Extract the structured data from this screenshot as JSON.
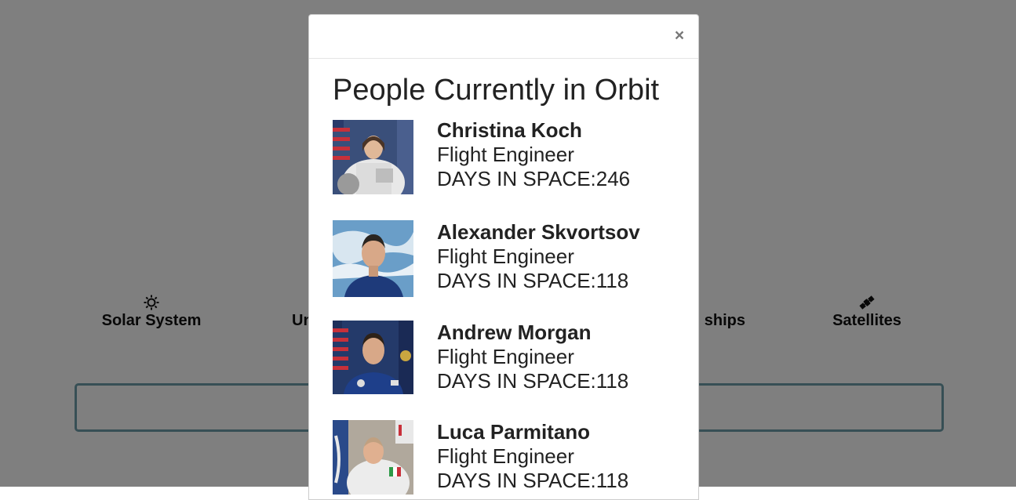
{
  "background": {
    "nav": [
      {
        "label": "Solar System",
        "icon": "sun-icon"
      },
      {
        "label": "Un",
        "icon": ""
      },
      {
        "label": "ships",
        "icon": ""
      },
      {
        "label": "Satellites",
        "icon": "satellite-icon"
      }
    ]
  },
  "modal": {
    "close_label": "×",
    "title": "People Currently in Orbit",
    "people": [
      {
        "name": "Christina Koch",
        "role": "Flight Engineer",
        "days_text": "DAYS IN SPACE:246"
      },
      {
        "name": "Alexander Skvortsov",
        "role": "Flight Engineer",
        "days_text": "DAYS IN SPACE:118"
      },
      {
        "name": "Andrew Morgan",
        "role": "Flight Engineer",
        "days_text": "DAYS IN SPACE:118"
      },
      {
        "name": "Luca Parmitano",
        "role": "Flight Engineer",
        "days_text": "DAYS IN SPACE:118"
      }
    ]
  },
  "colors": {
    "backdrop": "#808080",
    "search_border": "#6f9eaa",
    "text": "#222222"
  }
}
